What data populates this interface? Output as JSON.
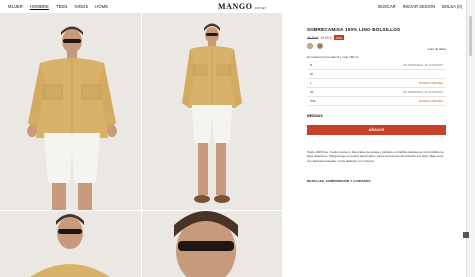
{
  "header": {
    "nav_left": [
      "MUJER",
      "HOMBRE",
      "TEEN",
      "NIÑOS",
      "HOME"
    ],
    "logo": "MANGO",
    "logo_sub": "OUTLET",
    "nav_right": [
      "BUSCAR",
      "INICIAR SESIÓN",
      "BOLSA (0)"
    ]
  },
  "product": {
    "title": "SOBRECAMISA 100% LINO BOLSILLOS",
    "price_old": "49,99 €",
    "price_new": "19,99 €",
    "discount_badge": "-60%",
    "size_guide": "Guía de tallas",
    "model_info": "El modelo lleva la talla M y mide 188 cm",
    "sizes": [
      {
        "size": "S",
        "note": "NO DISPONIBLE ¿TE AVISAMOS?",
        "warn": false
      },
      {
        "size": "M",
        "note": "",
        "warn": false
      },
      {
        "size": "L",
        "note": "ÚLTIMAS UNIDADES",
        "warn": true
      },
      {
        "size": "XL",
        "note": "NO DISPONIBLE ¿TE AVISAMOS?",
        "warn": false
      },
      {
        "size": "XXL",
        "note": "ÚLTIMAS UNIDADES",
        "warn": true
      }
    ],
    "measures_label": "MEDIDAS",
    "add_button": "AÑADIR",
    "description": "Tejido 100% lino. Cuello camisero. Decorativo de solapa y pañuelo en bolsillos delanteros. Dos bolsillos de flaps delanteros. Manga larga con puños abotonados. Cierre de botones abrochando a lo largo. Bajo recto con aberturas laterales. Corte delantero con heteros.",
    "details_label": "DETALLES, COMPOSICIÓN Y CUIDADOS"
  },
  "colors": {
    "accent": "#c7402a",
    "swatch_1": "#d8b46a",
    "swatch_2": "#a7765a"
  }
}
